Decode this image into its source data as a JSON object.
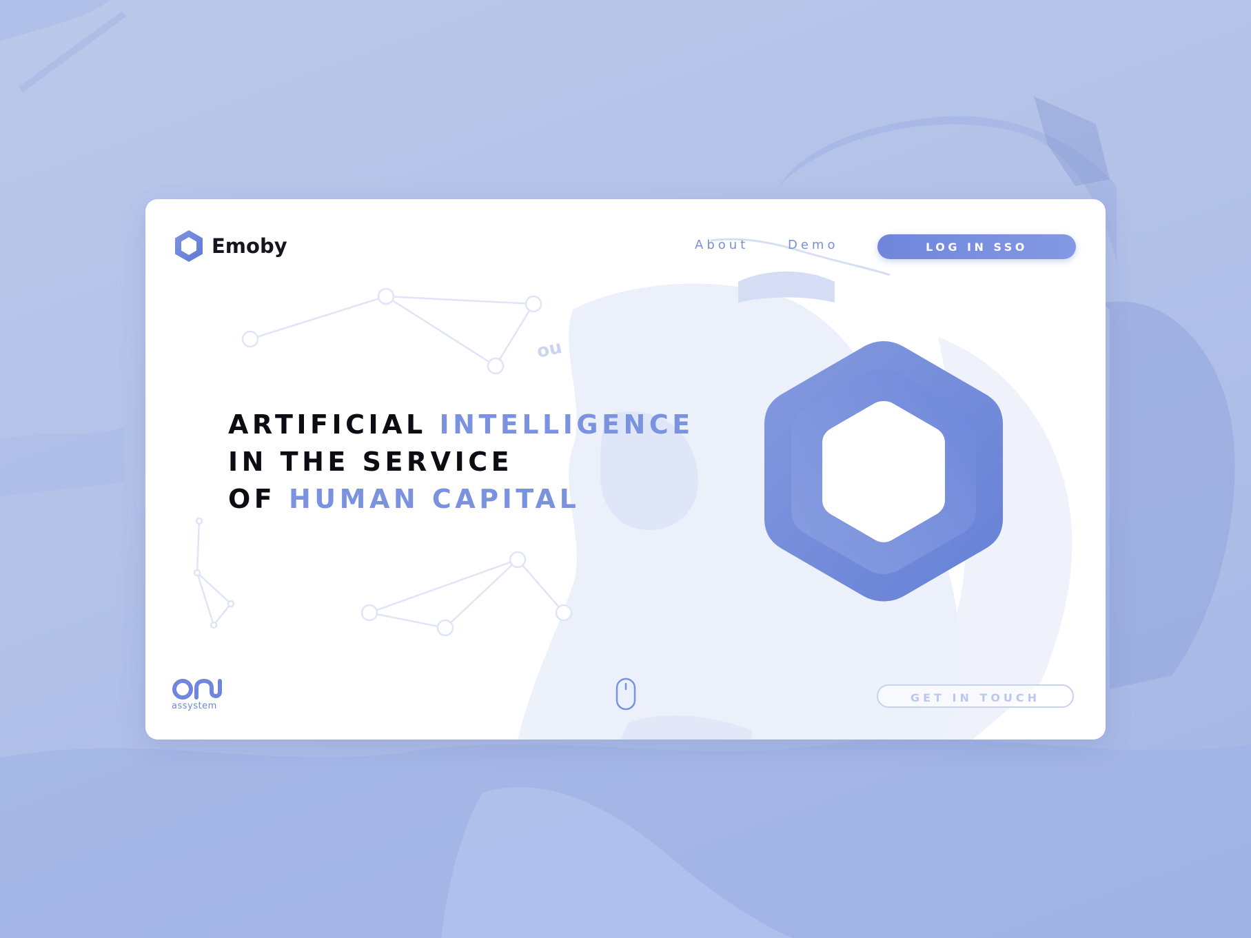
{
  "brand": {
    "name": "Emoby",
    "logo_icon": "hexagon-logo-icon"
  },
  "nav": {
    "about_label": "About",
    "demo_label": "Demo"
  },
  "header": {
    "login_label": "LOG IN SSO"
  },
  "hero": {
    "line1_dark": "ARTIFICIAL ",
    "line1_accent": "INTELLIGENCE",
    "line2_dark": "IN THE SERVICE",
    "line3_dark": "OF ",
    "line3_accent": "HUMAN CAPITAL"
  },
  "footer": {
    "partner_logo_text": "assystem",
    "scroll_icon": "mouse-scroll-icon",
    "contact_label": "GET IN TOUCH"
  },
  "colors": {
    "accent": "#7b92de",
    "button_gradient_start": "#6f86dc",
    "button_gradient_end": "#8399e2",
    "background": "#b3c1e8",
    "text_dark": "#0c0c12"
  }
}
